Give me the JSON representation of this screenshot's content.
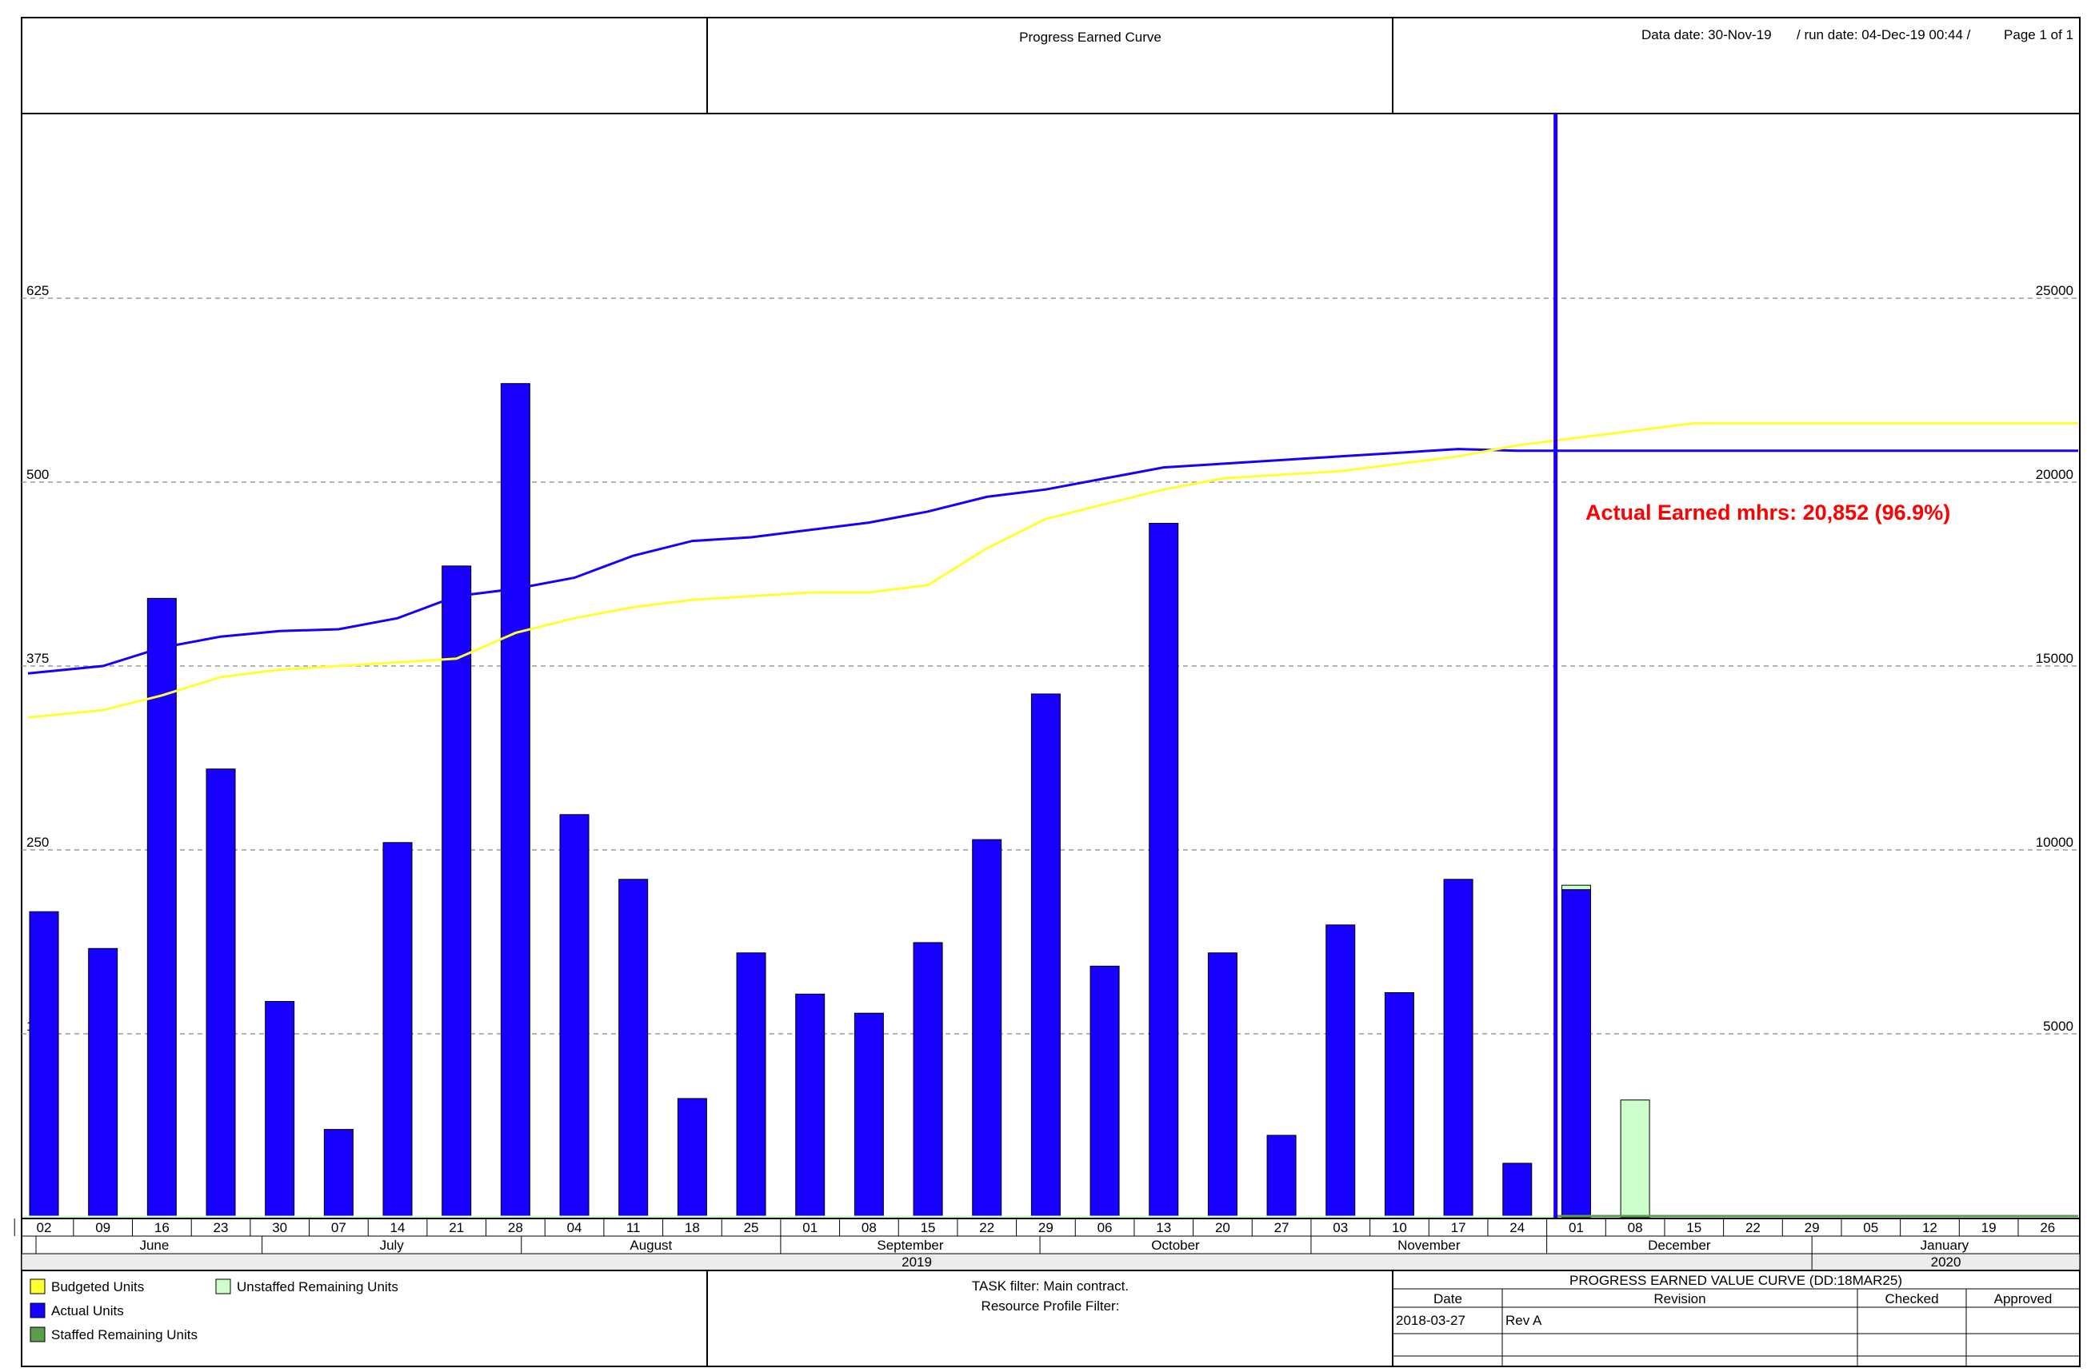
{
  "header": {
    "title": "Progress Earned Curve",
    "data_date": "Data date: 30-Nov-19",
    "run_date": "/ run date: 04-Dec-19 00:44 /",
    "page": "Page 1 of 1"
  },
  "chart_data": {
    "type": "bar",
    "title": "Progress Earned Curve",
    "left_axis": {
      "min": 0,
      "max": 750,
      "ticks": [
        125,
        250,
        375,
        500,
        625
      ]
    },
    "right_axis": {
      "min": 0,
      "max": 30000,
      "ticks": [
        5000,
        10000,
        15000,
        20000,
        25000
      ]
    },
    "grid": true,
    "x_week_labels": [
      "02",
      "09",
      "16",
      "23",
      "30",
      "07",
      "14",
      "21",
      "28",
      "04",
      "11",
      "18",
      "25",
      "01",
      "08",
      "15",
      "22",
      "29",
      "06",
      "13",
      "20",
      "27",
      "03",
      "10",
      "17",
      "24",
      "01",
      "08",
      "15",
      "22",
      "29",
      "05",
      "12",
      "19",
      "26"
    ],
    "months": [
      "June",
      "July",
      "August",
      "September",
      "October",
      "November",
      "December",
      "January"
    ],
    "years": [
      "2019",
      "2020"
    ],
    "series": [
      {
        "name": "Actual Units",
        "kind": "bar",
        "axis": "left",
        "color": "#1800ff",
        "values": [
          208,
          183,
          421,
          305,
          147,
          60,
          255,
          443,
          567,
          274,
          230,
          81,
          180,
          152,
          139,
          187,
          257,
          356,
          171,
          472,
          180,
          56,
          199,
          153,
          230,
          37,
          223
        ]
      },
      {
        "name": "Unstaffed Remaining Units",
        "kind": "bar",
        "axis": "left",
        "color": "#ccffcc",
        "values": [
          0,
          0,
          0,
          0,
          0,
          0,
          0,
          0,
          0,
          0,
          0,
          0,
          0,
          0,
          0,
          0,
          0,
          0,
          0,
          0,
          0,
          0,
          0,
          0,
          0,
          0,
          3,
          80,
          0,
          0,
          0,
          0,
          0,
          0,
          0
        ]
      },
      {
        "name": "Actual Earned (cumulative)",
        "kind": "line",
        "axis": "right",
        "color": "#1800ff",
        "values": [
          14800,
          15000,
          15500,
          15800,
          15950,
          16000,
          16300,
          16900,
          17100,
          17400,
          18000,
          18400,
          18500,
          18700,
          18900,
          19200,
          19600,
          19800,
          20100,
          20400,
          20500,
          20600,
          20700,
          20800,
          20900,
          20852,
          20852,
          20852,
          20852,
          20852,
          20852,
          20852,
          20852,
          20852,
          20852
        ]
      },
      {
        "name": "Budgeted Units (cumulative)",
        "kind": "line",
        "axis": "right",
        "color": "#ffff33",
        "values": [
          13600,
          13800,
          14200,
          14700,
          14900,
          15000,
          15100,
          15200,
          15900,
          16300,
          16600,
          16800,
          16900,
          17000,
          17000,
          17200,
          18200,
          19000,
          19400,
          19800,
          20100,
          20200,
          20300,
          20500,
          20700,
          21000,
          21200,
          21400,
          21600,
          21600,
          21600,
          21600,
          21600,
          21600,
          21600
        ]
      }
    ],
    "data_date_index": 26,
    "annotation": "Actual Earned mhrs: 20,852 (96.9%)"
  },
  "legend": {
    "budgeted": "Budgeted Units",
    "unstaffed": "Unstaffed Remaining Units",
    "actual": "Actual Units",
    "staffed": "Staffed Remaining Units"
  },
  "colors": {
    "budgeted": "#ffff33",
    "unstaffed": "#ccffcc",
    "actual": "#1800ff",
    "staffed": "#5a9e4a",
    "annotation": "#ff0000"
  },
  "footer": {
    "task_filter": "TASK filter: Main contract.",
    "resource_filter": "Resource Profile Filter:",
    "block_title": "PROGRESS EARNED VALUE CURVE (DD:18MAR25)",
    "col_date": "Date",
    "col_revision": "Revision",
    "col_checked": "Checked",
    "col_approved": "Approved",
    "row_date": "2018-03-27",
    "row_revision": "Rev A"
  }
}
